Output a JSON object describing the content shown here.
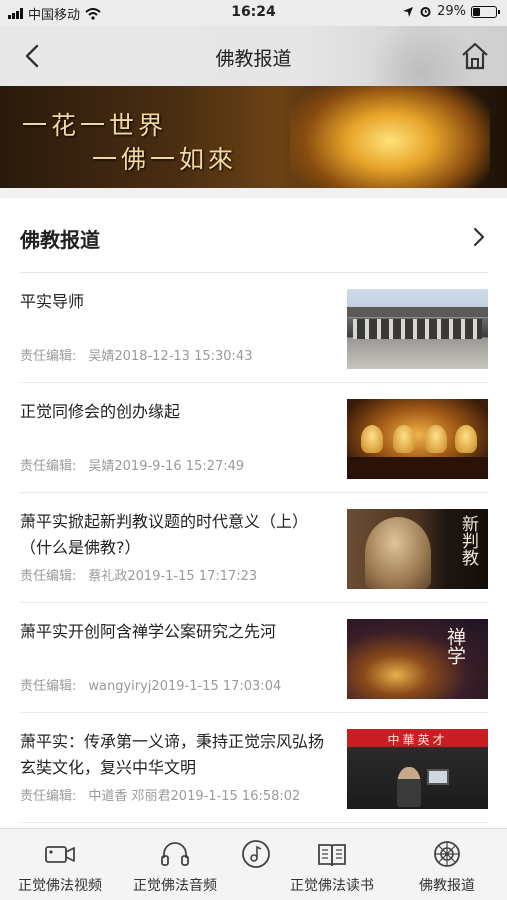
{
  "status_bar": {
    "carrier": "中国移动",
    "time": "16:24",
    "battery": "29%",
    "battery_level": 0.29
  },
  "nav": {
    "title": "佛教报道",
    "back_icon": "chevron-left-icon",
    "home_icon": "home-icon"
  },
  "banner": {
    "line1": "一花一世界",
    "line2": "一佛一如來"
  },
  "section": {
    "title": "佛教报道",
    "arrow_icon": "chevron-right-icon"
  },
  "news": [
    {
      "title": "平实导师",
      "editor_label": "责任编辑:",
      "meta": "吴婧2018-12-13 15:30:43"
    },
    {
      "title": "正觉同修会的创办缘起",
      "editor_label": "责任编辑:",
      "meta": "吴婧2019-9-16 15:27:49"
    },
    {
      "title": "萧平实掀起新判教议题的时代意义（上）（什么是佛教?）",
      "editor_label": "责任编辑:",
      "meta": "蔡礼政2019-1-15 17:17:23",
      "thumb_text": "新判教"
    },
    {
      "title": "萧平实开创阿含禅学公案研究之先河",
      "editor_label": "责任编辑:",
      "meta": "wangyiryj2019-1-15 17:03:04",
      "thumb_text": "禅学"
    },
    {
      "title": "萧平实：传承第一义谛，秉持正觉宗风弘扬玄奘文化，复兴中华文明",
      "editor_label": "责任编辑:",
      "meta": "中道香  邓丽君2019-1-15 16:58:02",
      "thumb_text": "中華英才"
    }
  ],
  "tabs": [
    {
      "label": "正觉佛法视频",
      "icon": "video-camera-icon"
    },
    {
      "label": "正觉佛法音频",
      "icon": "headphones-icon"
    },
    {
      "label": "",
      "icon": "music-disc-icon"
    },
    {
      "label": "正觉佛法读书",
      "icon": "book-icon"
    },
    {
      "label": "佛教报道",
      "icon": "dharma-wheel-icon"
    }
  ]
}
